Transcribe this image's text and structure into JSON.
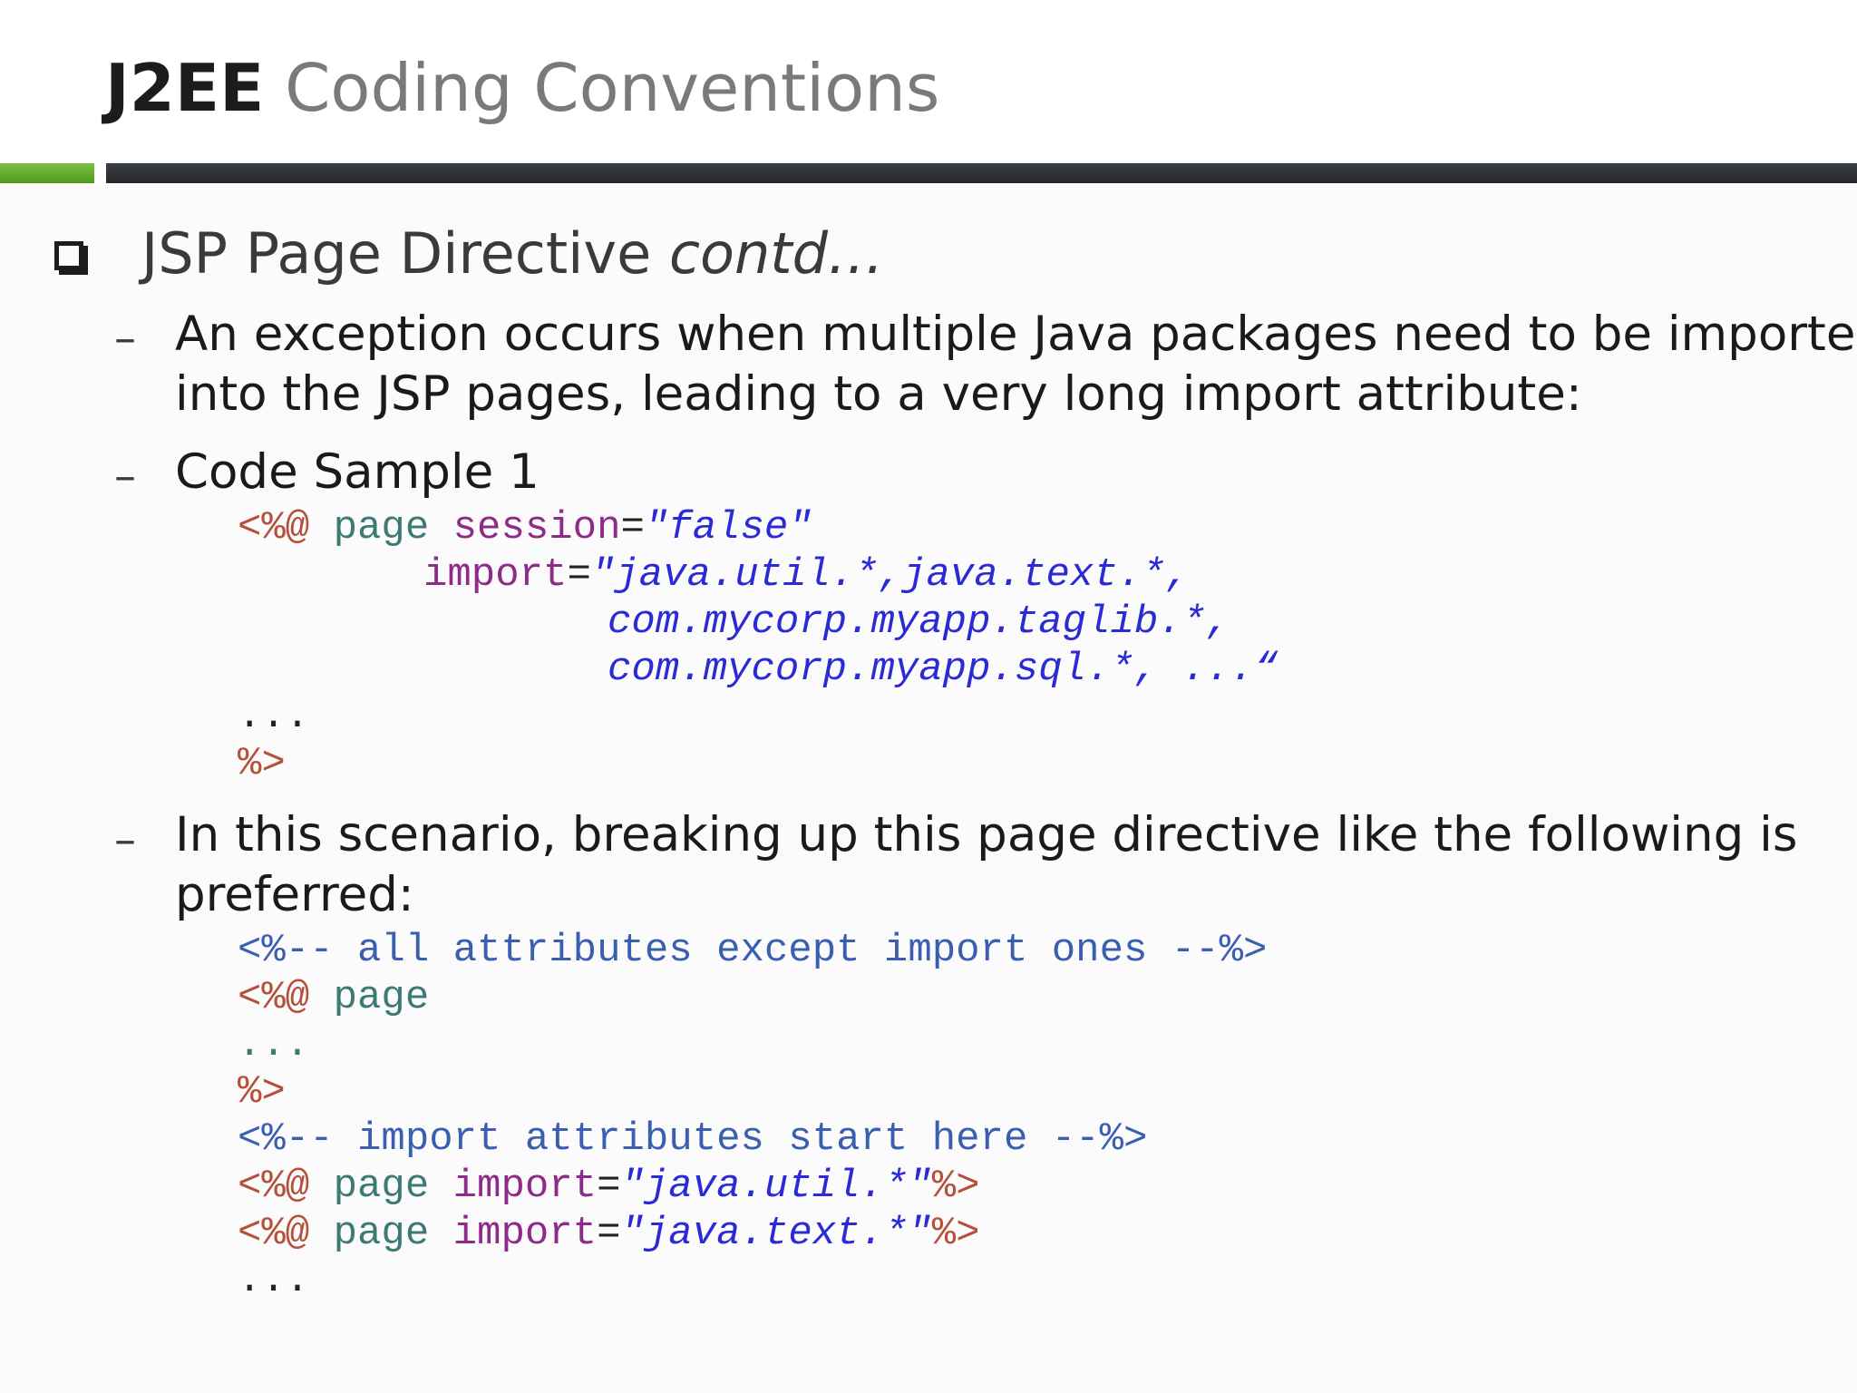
{
  "title": {
    "bold": "J2EE",
    "rest": " Coding Conventions"
  },
  "heading": {
    "main": "JSP Page Directive ",
    "italic": "contd…"
  },
  "bullets": [
    {
      "dash": "–",
      "text": [
        "An exception occurs when multiple Java packages need to be imported",
        "into the JSP pages, leading to a very long import attribute:"
      ]
    },
    {
      "dash": "–",
      "text": [
        "Code Sample 1"
      ]
    },
    {
      "dash": "–",
      "text": [
        "In this scenario, breaking up this page directive like the following is",
        "preferred:"
      ]
    }
  ],
  "code1": {
    "l1": {
      "tag": "<%@",
      "kw": " page",
      "attr": " session",
      "eq": "=",
      "val": "\"false\""
    },
    "l2": {
      "attr": "import",
      "eq": "=",
      "val": "\"java.util.*,java.text.*,"
    },
    "l3": {
      "val": "com.mycorp.myapp.taglib.*,"
    },
    "l4": {
      "val": "com.mycorp.myapp.sql.*, ...",
      "close": "“"
    },
    "l5": "...",
    "l6": "%>"
  },
  "code2": {
    "l1": {
      "open": "<%--",
      "cmt": " all attributes except import ones ",
      "close": "--%>"
    },
    "l2": {
      "tag": "<%@",
      "kw": " page"
    },
    "l3": "...",
    "l4": "%>",
    "l5": {
      "open": "<%--",
      "cmt": " import attributes start here ",
      "close": "--%>"
    },
    "l6": {
      "tag": "<%@",
      "kw": " page",
      "attr": " import",
      "eq": "=",
      "val": "\"java.util.*\"",
      "end": "%>"
    },
    "l7": {
      "tag": "<%@",
      "kw": " page",
      "attr": " import",
      "eq": "=",
      "val": "\"java.text.*\"",
      "end": "%>"
    },
    "l8": "..."
  }
}
